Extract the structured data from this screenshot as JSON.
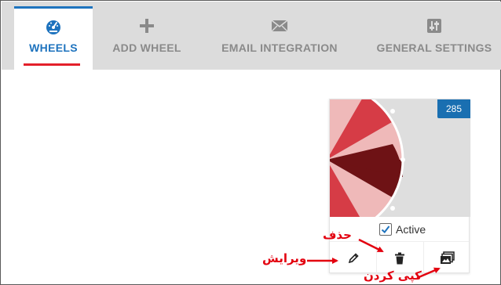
{
  "tabs": [
    {
      "label": "WHEELS",
      "icon": "dashboard-icon",
      "active": true
    },
    {
      "label": "ADD WHEEL",
      "icon": "plus-icon",
      "active": false
    },
    {
      "label": "EMAIL INTEGRATION",
      "icon": "envelope-icon",
      "active": false
    },
    {
      "label": "GENERAL SETTINGS",
      "icon": "sliders-icon",
      "active": false
    }
  ],
  "card": {
    "id_badge": "285",
    "status_label": "Active",
    "status_checked": true,
    "actions": [
      {
        "name": "edit",
        "icon": "pencil-icon"
      },
      {
        "name": "delete",
        "icon": "trash-icon"
      },
      {
        "name": "duplicate",
        "icon": "copy-images-icon"
      }
    ]
  },
  "annotations": {
    "delete": "حذف",
    "edit": "ویرایش",
    "duplicate": "کپی کردن"
  },
  "colors": {
    "accent": "#1e73be",
    "underline": "#e3202a",
    "badge": "#1a6fb1",
    "annotation": "#e3000f",
    "wheel_segments": [
      "#d63c46",
      "#efb9b9",
      "#6e1215",
      "#efb9b9",
      "#d63c46"
    ]
  }
}
